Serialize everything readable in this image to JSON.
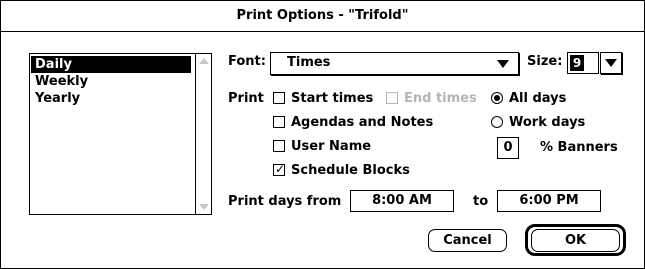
{
  "window": {
    "title": "Print Options - \"Trifold\""
  },
  "period_list": {
    "items": [
      "Daily",
      "Weekly",
      "Yearly"
    ],
    "selected": "Daily"
  },
  "font": {
    "label": "Font:",
    "value": "Times"
  },
  "size": {
    "label": "Size:",
    "value": "9"
  },
  "print": {
    "label": "Print",
    "start_times": {
      "label": "Start times",
      "checked": false
    },
    "end_times": {
      "label": "End times",
      "checked": false,
      "enabled": false
    },
    "agendas_notes": {
      "label": "Agendas and Notes",
      "checked": false
    },
    "user_name": {
      "label": "User Name",
      "checked": false
    },
    "schedule_blocks": {
      "label": "Schedule Blocks",
      "checked": true
    }
  },
  "days": {
    "all_days": {
      "label": "All days",
      "selected": true
    },
    "work_days": {
      "label": "Work days",
      "selected": false
    }
  },
  "banners": {
    "value": "0",
    "label": "% Banners"
  },
  "print_days": {
    "from_label": "Print days from",
    "from_value": "8:00 AM",
    "to_label": "to",
    "to_value": "6:00 PM"
  },
  "buttons": {
    "cancel": "Cancel",
    "ok": "OK"
  },
  "icons": {
    "check": "checkmark-icon",
    "popup": "triangle-down-icon",
    "scroll_up": "scroll-up-arrow-icon",
    "scroll_down": "scroll-down-arrow-icon"
  }
}
